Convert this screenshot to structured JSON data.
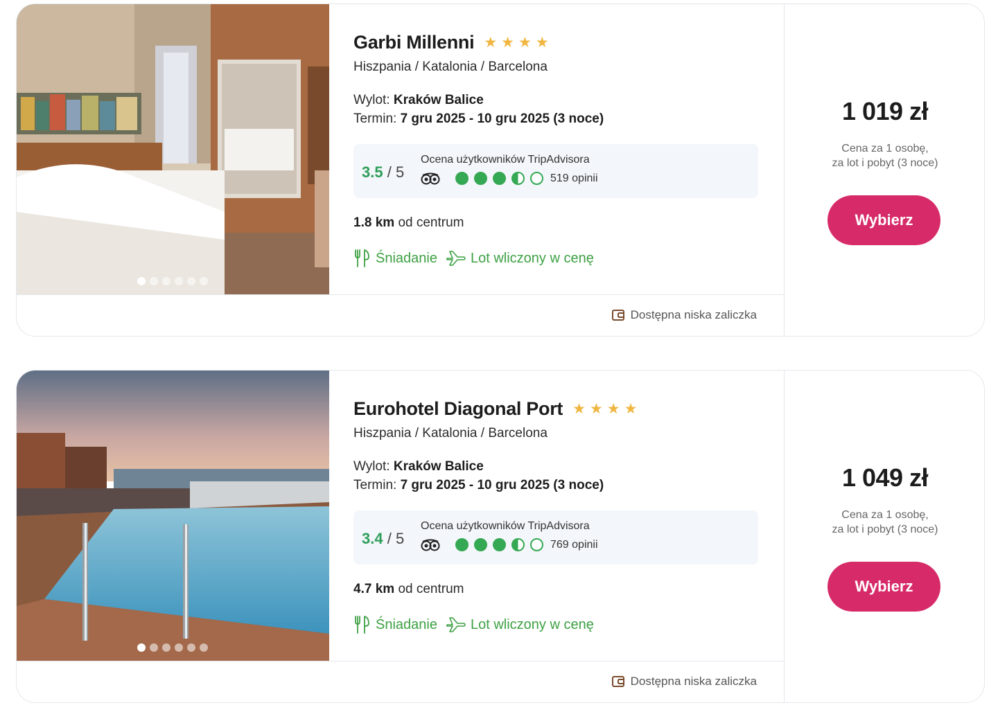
{
  "offers": [
    {
      "name": "Garbi Millenni",
      "stars": 4,
      "location": "Hiszpania / Katalonia / Barcelona",
      "departure_label": "Wylot:",
      "departure_value": "Kraków Balice",
      "term_label": "Termin:",
      "term_value": "7 gru 2025 - 10 gru 2025 (3 noce)",
      "rating_score": "3.5",
      "rating_of": "/ 5",
      "rating_source": "Ocena użytkowników TripAdvisora",
      "rating_value": 3.5,
      "reviews": "519 opinii",
      "distance_value": "1.8 km",
      "distance_label": "od centrum",
      "feature_breakfast": "Śniadanie",
      "feature_flight": "Lot wliczony w cenę",
      "deposit": "Dostępna niska zaliczka",
      "price": "1 019 zł",
      "price_note_1": "Cena za 1 osobę,",
      "price_note_2": "za lot i pobyt (3 noce)",
      "button": "Wybierz",
      "photo_count": 6,
      "photo_active": 0
    },
    {
      "name": "Eurohotel Diagonal Port",
      "stars": 4,
      "location": "Hiszpania / Katalonia / Barcelona",
      "departure_label": "Wylot:",
      "departure_value": "Kraków Balice",
      "term_label": "Termin:",
      "term_value": "7 gru 2025 - 10 gru 2025 (3 noce)",
      "rating_score": "3.4",
      "rating_of": "/ 5",
      "rating_source": "Ocena użytkowników TripAdvisora",
      "rating_value": 3.5,
      "reviews": "769 opinii",
      "distance_value": "4.7 km",
      "distance_label": "od centrum",
      "feature_breakfast": "Śniadanie",
      "feature_flight": "Lot wliczony w cenę",
      "deposit": "Dostępna niska zaliczka",
      "price": "1 049 zł",
      "price_note_1": "Cena za 1 osobę,",
      "price_note_2": "za lot i pobyt (3 noce)",
      "button": "Wybierz",
      "photo_count": 6,
      "photo_active": 0
    }
  ],
  "colors": {
    "accent": "#d62b68",
    "rating_green": "#34a853",
    "feature_green": "#3da043",
    "star": "#f0b640"
  }
}
